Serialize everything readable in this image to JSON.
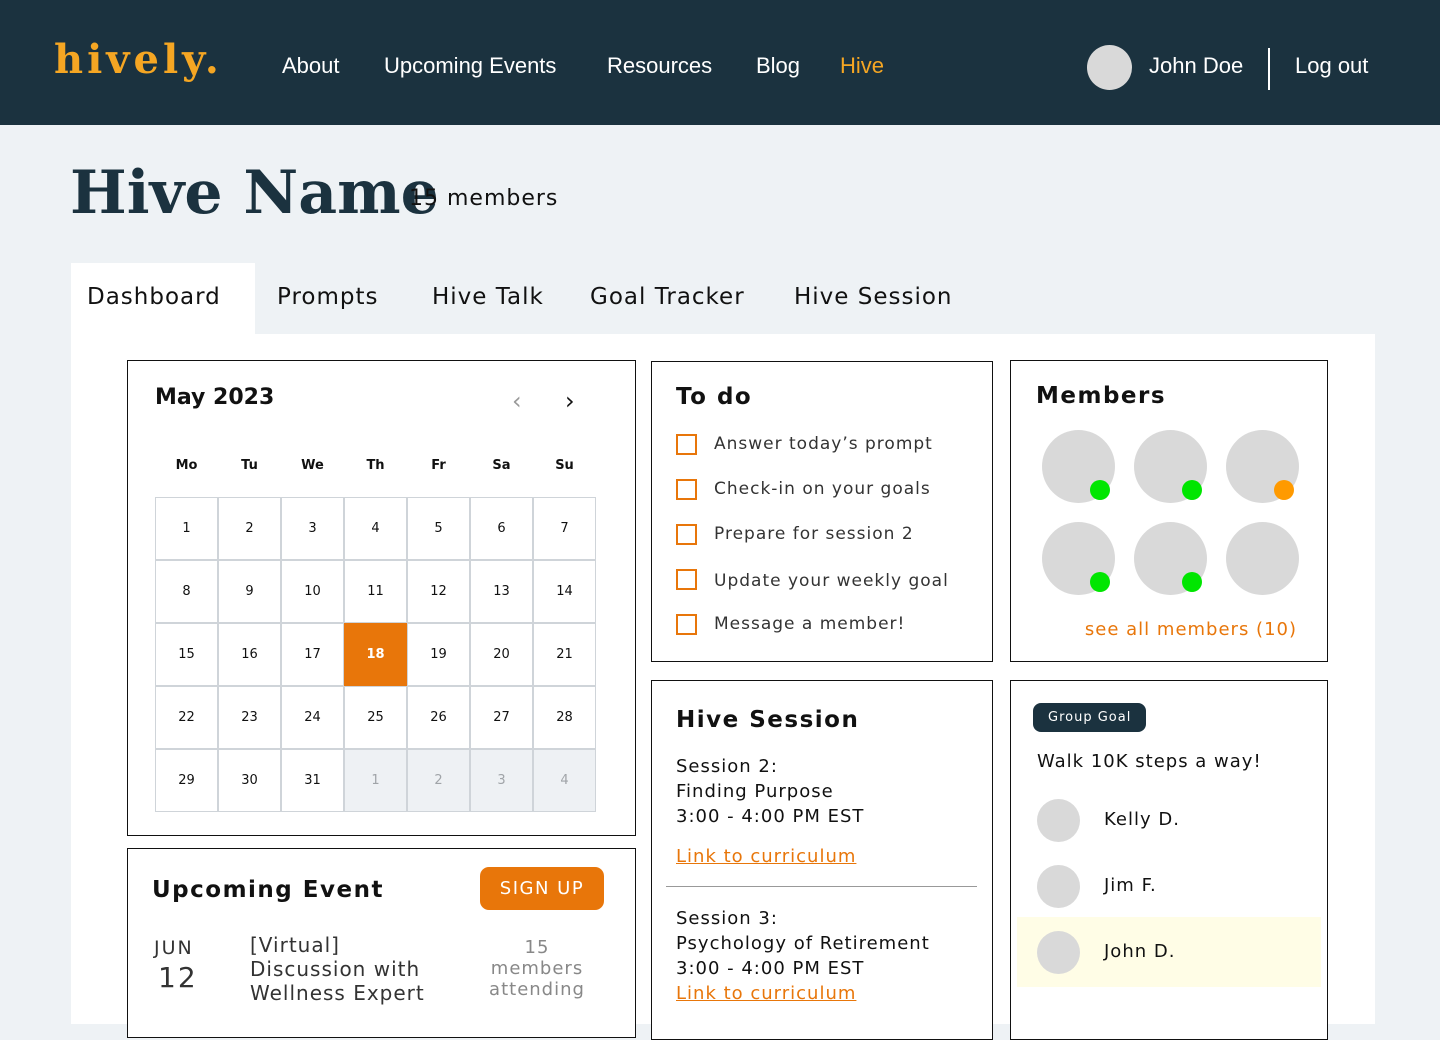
{
  "header": {
    "logo": "hively.",
    "nav": [
      {
        "label": "About",
        "active": false
      },
      {
        "label": "Upcoming Events",
        "active": false
      },
      {
        "label": "Resources",
        "active": false
      },
      {
        "label": "Blog",
        "active": false
      },
      {
        "label": "Hive",
        "active": true
      }
    ],
    "user_name": "John Doe",
    "logout_label": "Log out"
  },
  "hive": {
    "name": "Hive Name",
    "member_count": "15 members"
  },
  "tabs": [
    {
      "label": "Dashboard",
      "active": true
    },
    {
      "label": "Prompts",
      "active": false
    },
    {
      "label": "Hive Talk",
      "active": false
    },
    {
      "label": "Goal Tracker",
      "active": false
    },
    {
      "label": "Hive Session",
      "active": false
    }
  ],
  "calendar": {
    "month_label": "May 2023",
    "prev_icon": "chevron-left-icon",
    "next_icon": "chevron-right-icon",
    "weekdays": [
      "Mo",
      "Tu",
      "We",
      "Th",
      "Fr",
      "Sa",
      "Su"
    ],
    "weeks": [
      [
        "1",
        "2",
        "3",
        "4",
        "5",
        "6",
        "7"
      ],
      [
        "8",
        "9",
        "10",
        "11",
        "12",
        "13",
        "14"
      ],
      [
        "15",
        "16",
        "17",
        "18",
        "19",
        "20",
        "21"
      ],
      [
        "22",
        "23",
        "24",
        "25",
        "26",
        "27",
        "28"
      ],
      [
        "29",
        "30",
        "31",
        "1",
        "2",
        "3",
        "4"
      ]
    ],
    "today": "18",
    "next_month_days": [
      "1",
      "2",
      "3",
      "4"
    ]
  },
  "todo": {
    "title": "To do",
    "items": [
      "Answer today’s prompt",
      "Check-in on your goals",
      "Prepare for session 2",
      "Update your weekly goal",
      "Message a member!"
    ]
  },
  "members": {
    "title": "Members",
    "avatars": [
      {
        "status": "online"
      },
      {
        "status": "online"
      },
      {
        "status": "away"
      },
      {
        "status": "online"
      },
      {
        "status": "online"
      },
      {
        "status": "none"
      }
    ],
    "see_all_label": "see all members (10)",
    "colors": {
      "online": "#00e600",
      "away": "#ff9a00"
    }
  },
  "hive_session": {
    "title": "Hive Session",
    "sessions": [
      {
        "lines": [
          "Session 2:",
          "Finding Purpose",
          "3:00 - 4:00 PM EST"
        ],
        "link": "Link to curriculum"
      },
      {
        "lines": [
          "Session 3:",
          "Psychology of Retirement",
          "3:00 - 4:00 PM EST"
        ],
        "link": "Link to curriculum"
      }
    ]
  },
  "group_goal": {
    "badge": "Group Goal",
    "goal": "Walk 10K steps a way!",
    "participants": [
      {
        "name": "Kelly D.",
        "is_me": false
      },
      {
        "name": "Jim F.",
        "is_me": false
      },
      {
        "name": "John D.",
        "is_me": true
      }
    ]
  },
  "upcoming_event": {
    "title": "Upcoming Event",
    "signup_label": "SIGN UP",
    "month": "JUN",
    "day": "12",
    "event_lines": [
      "[Virtual]",
      "Discussion with",
      "Wellness Expert"
    ],
    "attending_lines": [
      "15",
      "members",
      "attending"
    ]
  }
}
